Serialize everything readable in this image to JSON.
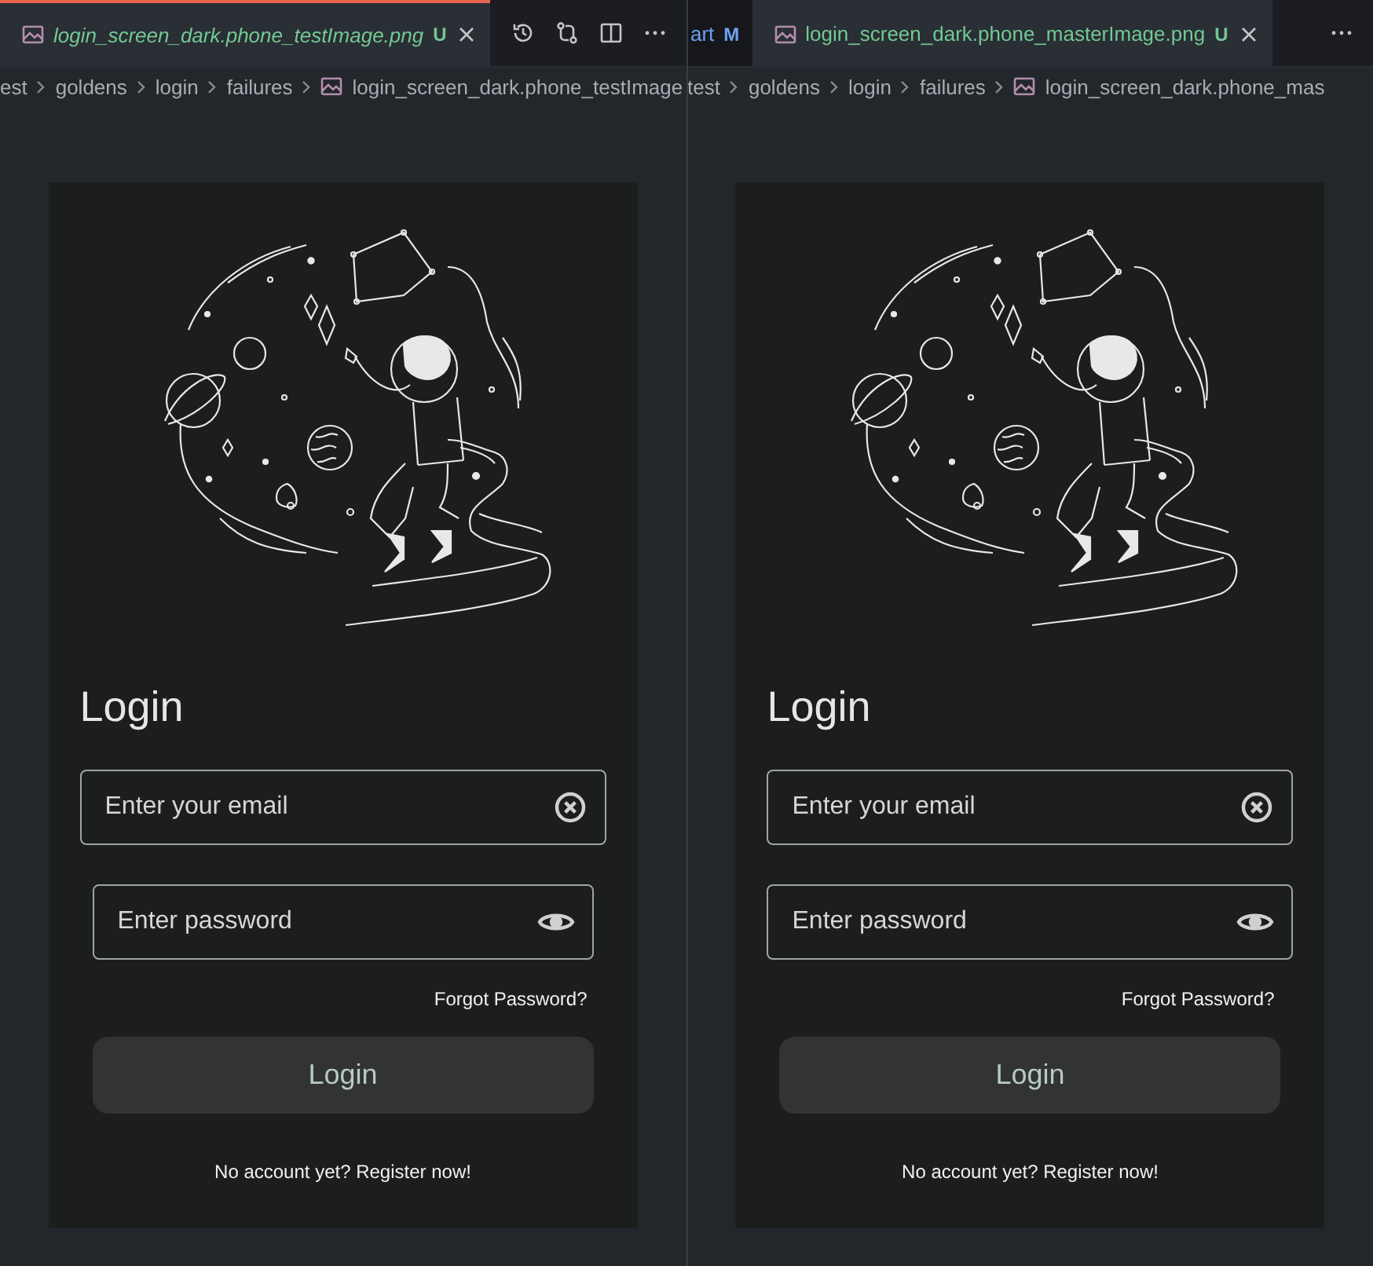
{
  "panes": [
    {
      "tabs": [
        {
          "label": "login_screen_dark.phone_testImage.png",
          "status": "U",
          "preview": true,
          "selected": true,
          "focused": true,
          "closable": true
        }
      ],
      "breadcrumb": [
        "est",
        "goldens",
        "login",
        "failures"
      ],
      "file": "login_screen_dark.phone_testImage",
      "screen": {
        "title": "Login",
        "fields": [
          {
            "kind": "email",
            "placeholder": "Enter your email",
            "inset": false
          },
          {
            "kind": "password",
            "placeholder": "Enter password",
            "inset": true
          }
        ],
        "forgot": "Forgot Password?",
        "button": "Login",
        "register": "No account yet? Register now!"
      }
    },
    {
      "tabs": [
        {
          "label": "art",
          "status": "M",
          "preview": false,
          "selected": false,
          "focused": false,
          "closable": false
        },
        {
          "label": "login_screen_dark.phone_masterImage.png",
          "status": "U",
          "preview": false,
          "selected": true,
          "focused": false,
          "closable": true
        }
      ],
      "breadcrumb": [
        "test",
        "goldens",
        "login",
        "failures"
      ],
      "file": "login_screen_dark.phone_mas",
      "screen": {
        "title": "Login",
        "fields": [
          {
            "kind": "email",
            "placeholder": "Enter your email",
            "inset": false
          },
          {
            "kind": "password",
            "placeholder": "Enter password",
            "inset": false
          }
        ],
        "forgot": "Forgot Password?",
        "button": "Login",
        "register": "No account yet? Register now!"
      }
    }
  ]
}
